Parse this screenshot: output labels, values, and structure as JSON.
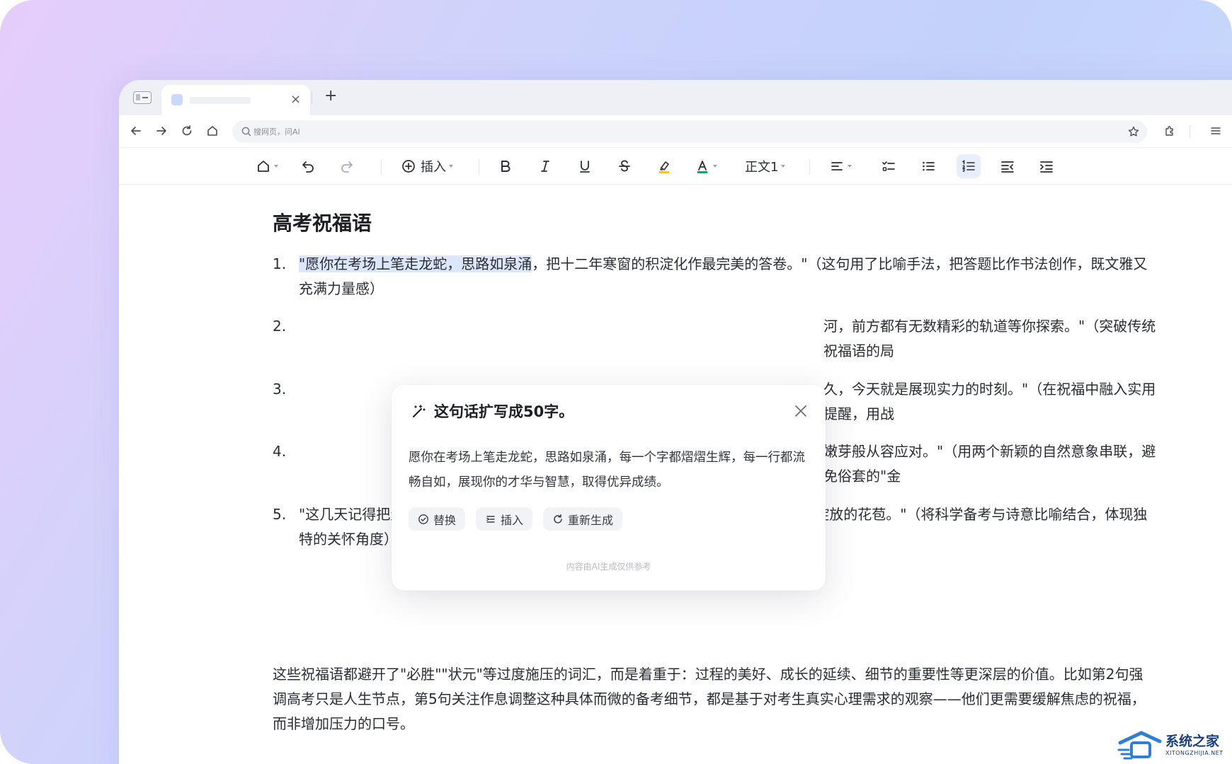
{
  "browser": {
    "tab": {
      "close_glyph": "×"
    },
    "new_tab_glyph": "+",
    "address": {
      "placeholder": "搜网页，问AI"
    }
  },
  "toolbar": {
    "insert_label": "插入",
    "style_label": "正文1",
    "colors": {
      "highlight": "#f4c430",
      "font_color": "#1aa365",
      "active_bg": "#e8eefc"
    }
  },
  "document": {
    "title": "高考祝福语",
    "items": [
      {
        "num": "1.",
        "highlight": "\"愿你在考场上笔走龙蛇，思路如泉涌",
        "rest": "，把十二年寒窗的积淀化作最完美的答卷。\"（这句用了比喻手法，把答题比作书法创作，既文雅又充满力量感）"
      },
      {
        "num": "2.",
        "visible": "河，前方都有无数精彩的轨道等你探索。\"（突破传统祝福语的局"
      },
      {
        "num": "3.",
        "visible": "久，今天就是展现实力的时刻。\"（在祝福中融入实用提醒，用战"
      },
      {
        "num": "4.",
        "visible": "嫩芽般从容应对。\"（用两个新颖的自然意象串联，避免俗套的\"金"
      },
      {
        "num": "5.",
        "text": "\"这几天记得把生物钟调到最佳状态，你积累的知识正在等待被唤醒，就像春天等待绽放的花苞。\"（将科学备考与诗意比喻结合，体现独特的关怀角度）"
      }
    ],
    "paragraph": "这些祝福语都避开了\"必胜\"\"状元\"等过度施压的词汇，而是着重于：过程的美好、成长的延续、细节的重要性等更深层的价值。比如第2句强调高考只是人生节点，第5句关注作息调整这种具体而微的备考细节，都是基于对考生真实心理需求的观察——他们更需要缓解焦虑的祝福，而非增加压力的口号。"
  },
  "ai_popup": {
    "title": "这句话扩写成50字。",
    "body": "愿你在考场上笔走龙蛇，思路如泉涌，每一个字都熠熠生辉，每一行都流畅自如，展现你的才华与智慧，取得优异成绩。",
    "buttons": {
      "replace": "替换",
      "insert": "插入",
      "regenerate": "重新生成"
    },
    "footer": "内容由AI生成仅供参考"
  },
  "watermark": {
    "name": "系统之家",
    "url": "XITONGZHIJIA.NET"
  }
}
